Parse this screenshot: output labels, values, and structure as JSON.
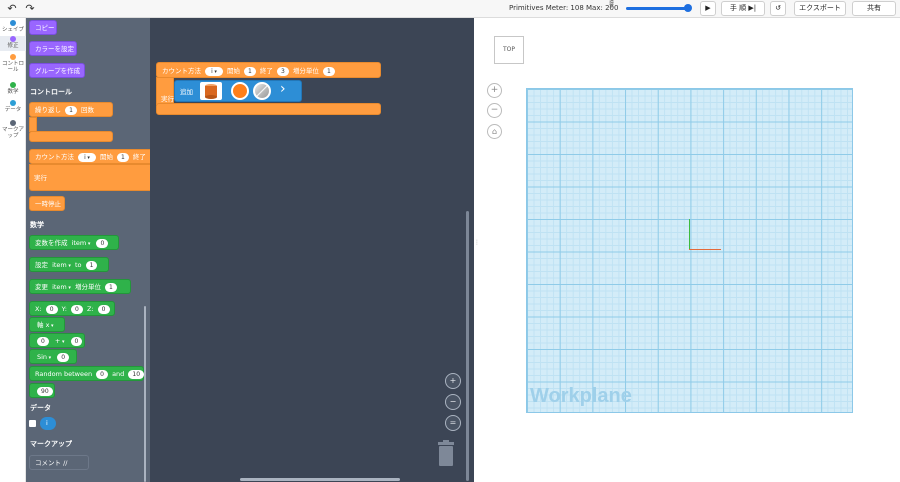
{
  "toolbar": {
    "undo_icon": "undo-icon",
    "redo_icon": "redo-icon",
    "meter_label": "Primitives Meter: 108 Max: 200",
    "meter_sub": "遠 景",
    "step_label": "手 順",
    "export_label": "エクスポート",
    "share_label": "共有"
  },
  "categories": [
    {
      "label": "シェイプ",
      "color": "#2d8ed6"
    },
    {
      "label": "修正",
      "color": "#9966ff"
    },
    {
      "label": "コントロール",
      "color": "#ff9c3f"
    },
    {
      "label": "数学",
      "color": "#2fb24a"
    },
    {
      "label": "データ",
      "color": "#2d9fd6"
    },
    {
      "label": "マークアップ",
      "color": "#5b6676"
    }
  ],
  "flyout": {
    "copy": "コピー",
    "set_color": "カラーを設定",
    "create_group": "グループを作成",
    "control_header": "コントロール",
    "repeat_label": "繰り返し",
    "repeat_count": "1",
    "repeat_times": "回数",
    "count_label": "カウント方法",
    "count_var": "i",
    "count_start_label": "開始",
    "count_start": "1",
    "count_end_label": "終了",
    "count_do": "実行",
    "pause": "一時停止",
    "math_header": "数学",
    "create_var": "変数を作成",
    "var_item": "item",
    "var_init": "0",
    "set_label": "設定",
    "to_label": "to",
    "set_value": "1",
    "change_label": "変更",
    "change_by_label": "増分単位",
    "change_value": "1",
    "x_label": "X:",
    "x_val": "0",
    "y_label": "Y:",
    "y_val": "0",
    "z_label": "Z:",
    "z_val": "0",
    "axis_label": "軸 x",
    "op_a": "0",
    "op": "+",
    "op_b": "0",
    "sin_label": "Sin",
    "sin_val": "0",
    "random_label": "Random between",
    "random_min": "0",
    "random_and": "and",
    "random_max": "10",
    "number": "90",
    "data_header": "データ",
    "data_var": "i",
    "markup_header": "マークアップ",
    "comment": "コメント //"
  },
  "workspace": {
    "loop_label": "カウント方法",
    "loop_var": "i",
    "loop_start_label": "開始",
    "loop_start": "1",
    "loop_end_label": "終了",
    "loop_end": "3",
    "loop_step_label": "増分単位",
    "loop_step": "1",
    "do_label": "実行",
    "add_label": "追加",
    "zoom_in": "+",
    "zoom_out": "−",
    "zoom_reset": "="
  },
  "viewport": {
    "viewcube_label": "TOP",
    "workplane_label": "Workplane",
    "nav_zoom_in": "+",
    "nav_zoom_out": "−",
    "nav_home": "⌂"
  }
}
